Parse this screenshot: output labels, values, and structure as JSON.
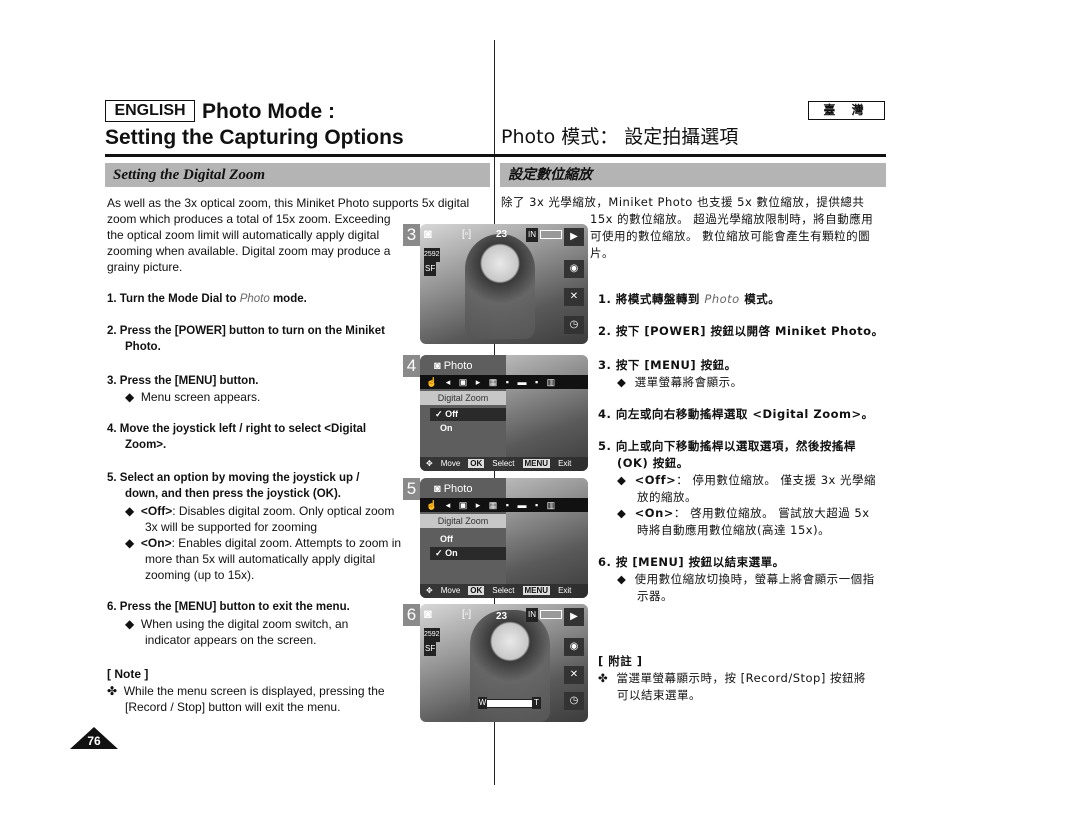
{
  "header": {
    "language_badge": "ENGLISH",
    "title_line1": "Photo Mode :",
    "title_line2": "Setting the Capturing Options",
    "region_badge": "臺 灣",
    "title_zh": "Photo  模式： 設定拍攝選項"
  },
  "section": {
    "title_en": "Setting the Digital Zoom",
    "title_zh": "設定數位縮放"
  },
  "english": {
    "intro": [
      "As well as the 3x optical zoom, this Miniket Photo supports 5x digital",
      "zoom which produces a total of 15x zoom. Exceeding",
      "the optical zoom limit will automatically apply digital",
      "zooming when available. Digital zoom may produce a",
      "grainy picture."
    ],
    "step1": {
      "pre": "1.  Turn the Mode Dial to ",
      "mode": "Photo",
      "post": " mode."
    },
    "step2": [
      "2.  Press the [POWER] button to turn on the Miniket",
      "Photo."
    ],
    "step3": "3.  Press the [MENU] button.",
    "step3_bullet": "Menu screen appears.",
    "step4": [
      "4.  Move the joystick left / right to select <Digital",
      "Zoom>."
    ],
    "step5": [
      "5.  Select an option by moving the joystick up /",
      "down, and then press the joystick (OK)."
    ],
    "off_bullet": {
      "key": "<Off>",
      "text": ": Disables digital zoom. Only optical zoom",
      "line2": "3x will be supported for zooming"
    },
    "on_bullet": {
      "key": "<On>",
      "text": ": Enables digital zoom. Attempts to zoom in",
      "line2": "more than 5x will automatically apply digital",
      "line3": "zooming (up to 15x)."
    },
    "step6": "6.  Press the [MENU] button to exit the menu.",
    "step6_bullet": [
      "When using the digital zoom switch, an",
      "indicator appears on the screen."
    ],
    "note_title": "[ Note ]",
    "note": [
      "While the menu screen is displayed, pressing the",
      "[Record / Stop] button will exit the menu."
    ]
  },
  "chinese": {
    "intro": [
      "除了 3x 光學縮放，Miniket Photo 也支援 5x 數位縮放，提供總共",
      "15x 的數位縮放。 超過光學縮放限制時，將自動應用",
      "可使用的數位縮放。 數位縮放可能會產生有顆粒的圖",
      "片。"
    ],
    "step1": {
      "pre": "1.  將模式轉盤轉到 ",
      "mode": "Photo",
      "post": " 模式。"
    },
    "step2": "2.  按下 [POWER] 按鈕以開啓 Miniket Photo。",
    "step3": "3.  按下 [MENU] 按鈕。",
    "step3_bullet": "選單螢幕將會顯示。",
    "step4": "4.  向左或向右移動搖桿選取 <Digital Zoom>。",
    "step5": [
      "5.  向上或向下移動搖桿以選取選項，然後按搖桿",
      "(OK) 按鈕。"
    ],
    "off_bullet": {
      "key": "<Off>",
      "text": "： 停用數位縮放。 僅支援 3x 光學縮",
      "line2": "放的縮放。"
    },
    "on_bullet": {
      "key": "<On>",
      "text": "： 啓用數位縮放。 嘗試放大超過 5x",
      "line2": "時將自動應用數位縮放(高達 15x)。"
    },
    "step6": "6.  按 [MENU] 按鈕以結束選單。",
    "step6_bullet": [
      "使用數位縮放切換時，螢幕上將會顯示一個指",
      "示器。"
    ],
    "note_title": "[ 附註 ]",
    "note": [
      "當選單螢幕顯示時，按 [Record/Stop] 按鈕將",
      "可以結束選單。"
    ]
  },
  "screens": {
    "s3": {
      "step": "3",
      "count": "23",
      "memory": "IN",
      "resolution": "2592",
      "quality": "SF"
    },
    "s4": {
      "step": "4",
      "mode": "Photo",
      "menu_title": "Digital Zoom",
      "options": [
        "Off",
        "On"
      ],
      "selected": "Off",
      "check": "✓",
      "foot_move": "Move",
      "foot_ok": "OK",
      "foot_select": "Select",
      "foot_menu": "MENU",
      "foot_exit": "Exit"
    },
    "s5": {
      "step": "5",
      "mode": "Photo",
      "menu_title": "Digital Zoom",
      "options": [
        "Off",
        "On"
      ],
      "selected": "On",
      "check": "✓",
      "foot_move": "Move",
      "foot_ok": "OK",
      "foot_select": "Select",
      "foot_menu": "MENU",
      "foot_exit": "Exit"
    },
    "s6": {
      "step": "6",
      "count": "23",
      "memory": "IN",
      "resolution": "2592",
      "quality": "SF",
      "zoom_wide": "W",
      "zoom_tele": "T"
    }
  },
  "symbols": {
    "diamond": "◆",
    "cross": "✤",
    "camera": "📷"
  },
  "page_number": "76",
  "colors": {
    "section_bar": "#b4b4b4",
    "step_badge": "#8a8a8a"
  }
}
